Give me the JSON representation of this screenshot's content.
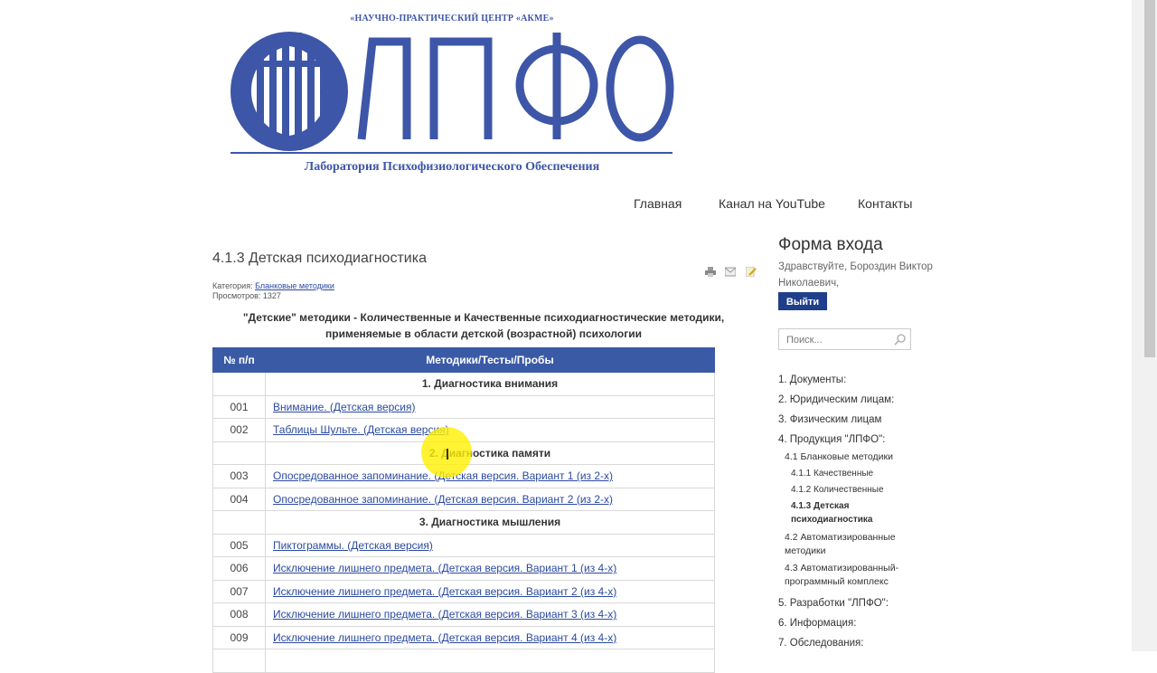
{
  "logo": {
    "top_text": "«НАУЧНО-ПРАКТИЧЕСКИЙ ЦЕНТР «АКМЕ»",
    "brand": "ЛПФО",
    "subtitle": "Лаборатория Психофизиологического Обеспечения",
    "brand_color": "#3e56a8"
  },
  "nav": {
    "home": "Главная",
    "youtube": "Канал на YouTube",
    "contacts": "Контакты"
  },
  "article": {
    "title": "4.1.3 Детская психодиагностика",
    "category_label": "Категория:",
    "category_link": "Бланковые методики",
    "views": "Просмотров: 1327",
    "intro": "\"Детские\" методики - Количественные и Качественные психодиагностические методики, применяемые в области детской (возрастной) психологии",
    "icons": [
      "print-icon",
      "email-icon",
      "edit-icon"
    ]
  },
  "table": {
    "headers": [
      "№ п/п",
      "Методики/Тесты/Пробы"
    ],
    "header_color": "#3b5aa6",
    "rows": [
      {
        "num": "",
        "name": "1. Диагностика внимания",
        "section": true
      },
      {
        "num": "001",
        "name": "Внимание. (Детская версия)"
      },
      {
        "num": "002",
        "name": "Таблицы Шульте. (Детская версия)"
      },
      {
        "num": "",
        "name": "2. Диагностика памяти",
        "section": true
      },
      {
        "num": "003",
        "name": "Опосредованное запоминание. (Детская версия. Вариант 1 (из 2-х)"
      },
      {
        "num": "004",
        "name": "Опосредованное запоминание. (Детская версия. Вариант 2 (из 2-х)"
      },
      {
        "num": "",
        "name": "3. Диагностика мышления",
        "section": true
      },
      {
        "num": "005",
        "name": "Пиктограммы. (Детская версия)"
      },
      {
        "num": "006",
        "name": "Исключение лишнего предмета. (Детская версия. Вариант 1 (из 4-х)"
      },
      {
        "num": "007",
        "name": "Исключение лишнего предмета. (Детская версия. Вариант 2 (из 4-х)"
      },
      {
        "num": "008",
        "name": "Исключение лишнего предмета. (Детская версия. Вариант 3 (из 4-х)"
      },
      {
        "num": "009",
        "name": "Исключение лишнего предмета. (Детская версия. Вариант 4 (из 4-х)"
      },
      {
        "num": "",
        "name": ""
      }
    ]
  },
  "sidebar": {
    "login_title": "Форма входа",
    "greeting": "Здравствуйте, Бороздин Виктор Николаевич,",
    "logout": "Выйти",
    "search_placeholder": "Поиск...",
    "menu": [
      {
        "label": "1. Документы:",
        "level": 1
      },
      {
        "label": "2. Юридическим лицам:",
        "level": 1
      },
      {
        "label": "3. Физическим лицам",
        "level": 1
      },
      {
        "label": "4. Продукция \"ЛПФО\":",
        "level": 1
      },
      {
        "label": "4.1 Бланковые методики",
        "level": 2
      },
      {
        "label": "4.1.1 Качественные",
        "level": 3
      },
      {
        "label": "4.1.2 Количественные",
        "level": 3
      },
      {
        "label": "4.1.3 Детская",
        "label2": "психодиагностика",
        "level": 3,
        "active": true
      },
      {
        "label": "4.2 Автоматизированные",
        "label2": "методики",
        "level": 2
      },
      {
        "label": "4.3 Автоматизированный-",
        "label2": "программный комплекс",
        "level": 2
      },
      {
        "label": "5. Разработки \"ЛПФО\":",
        "level": 1
      },
      {
        "label": "6. Информация:",
        "level": 1
      },
      {
        "label": "7. Обследования:",
        "level": 1
      }
    ]
  }
}
